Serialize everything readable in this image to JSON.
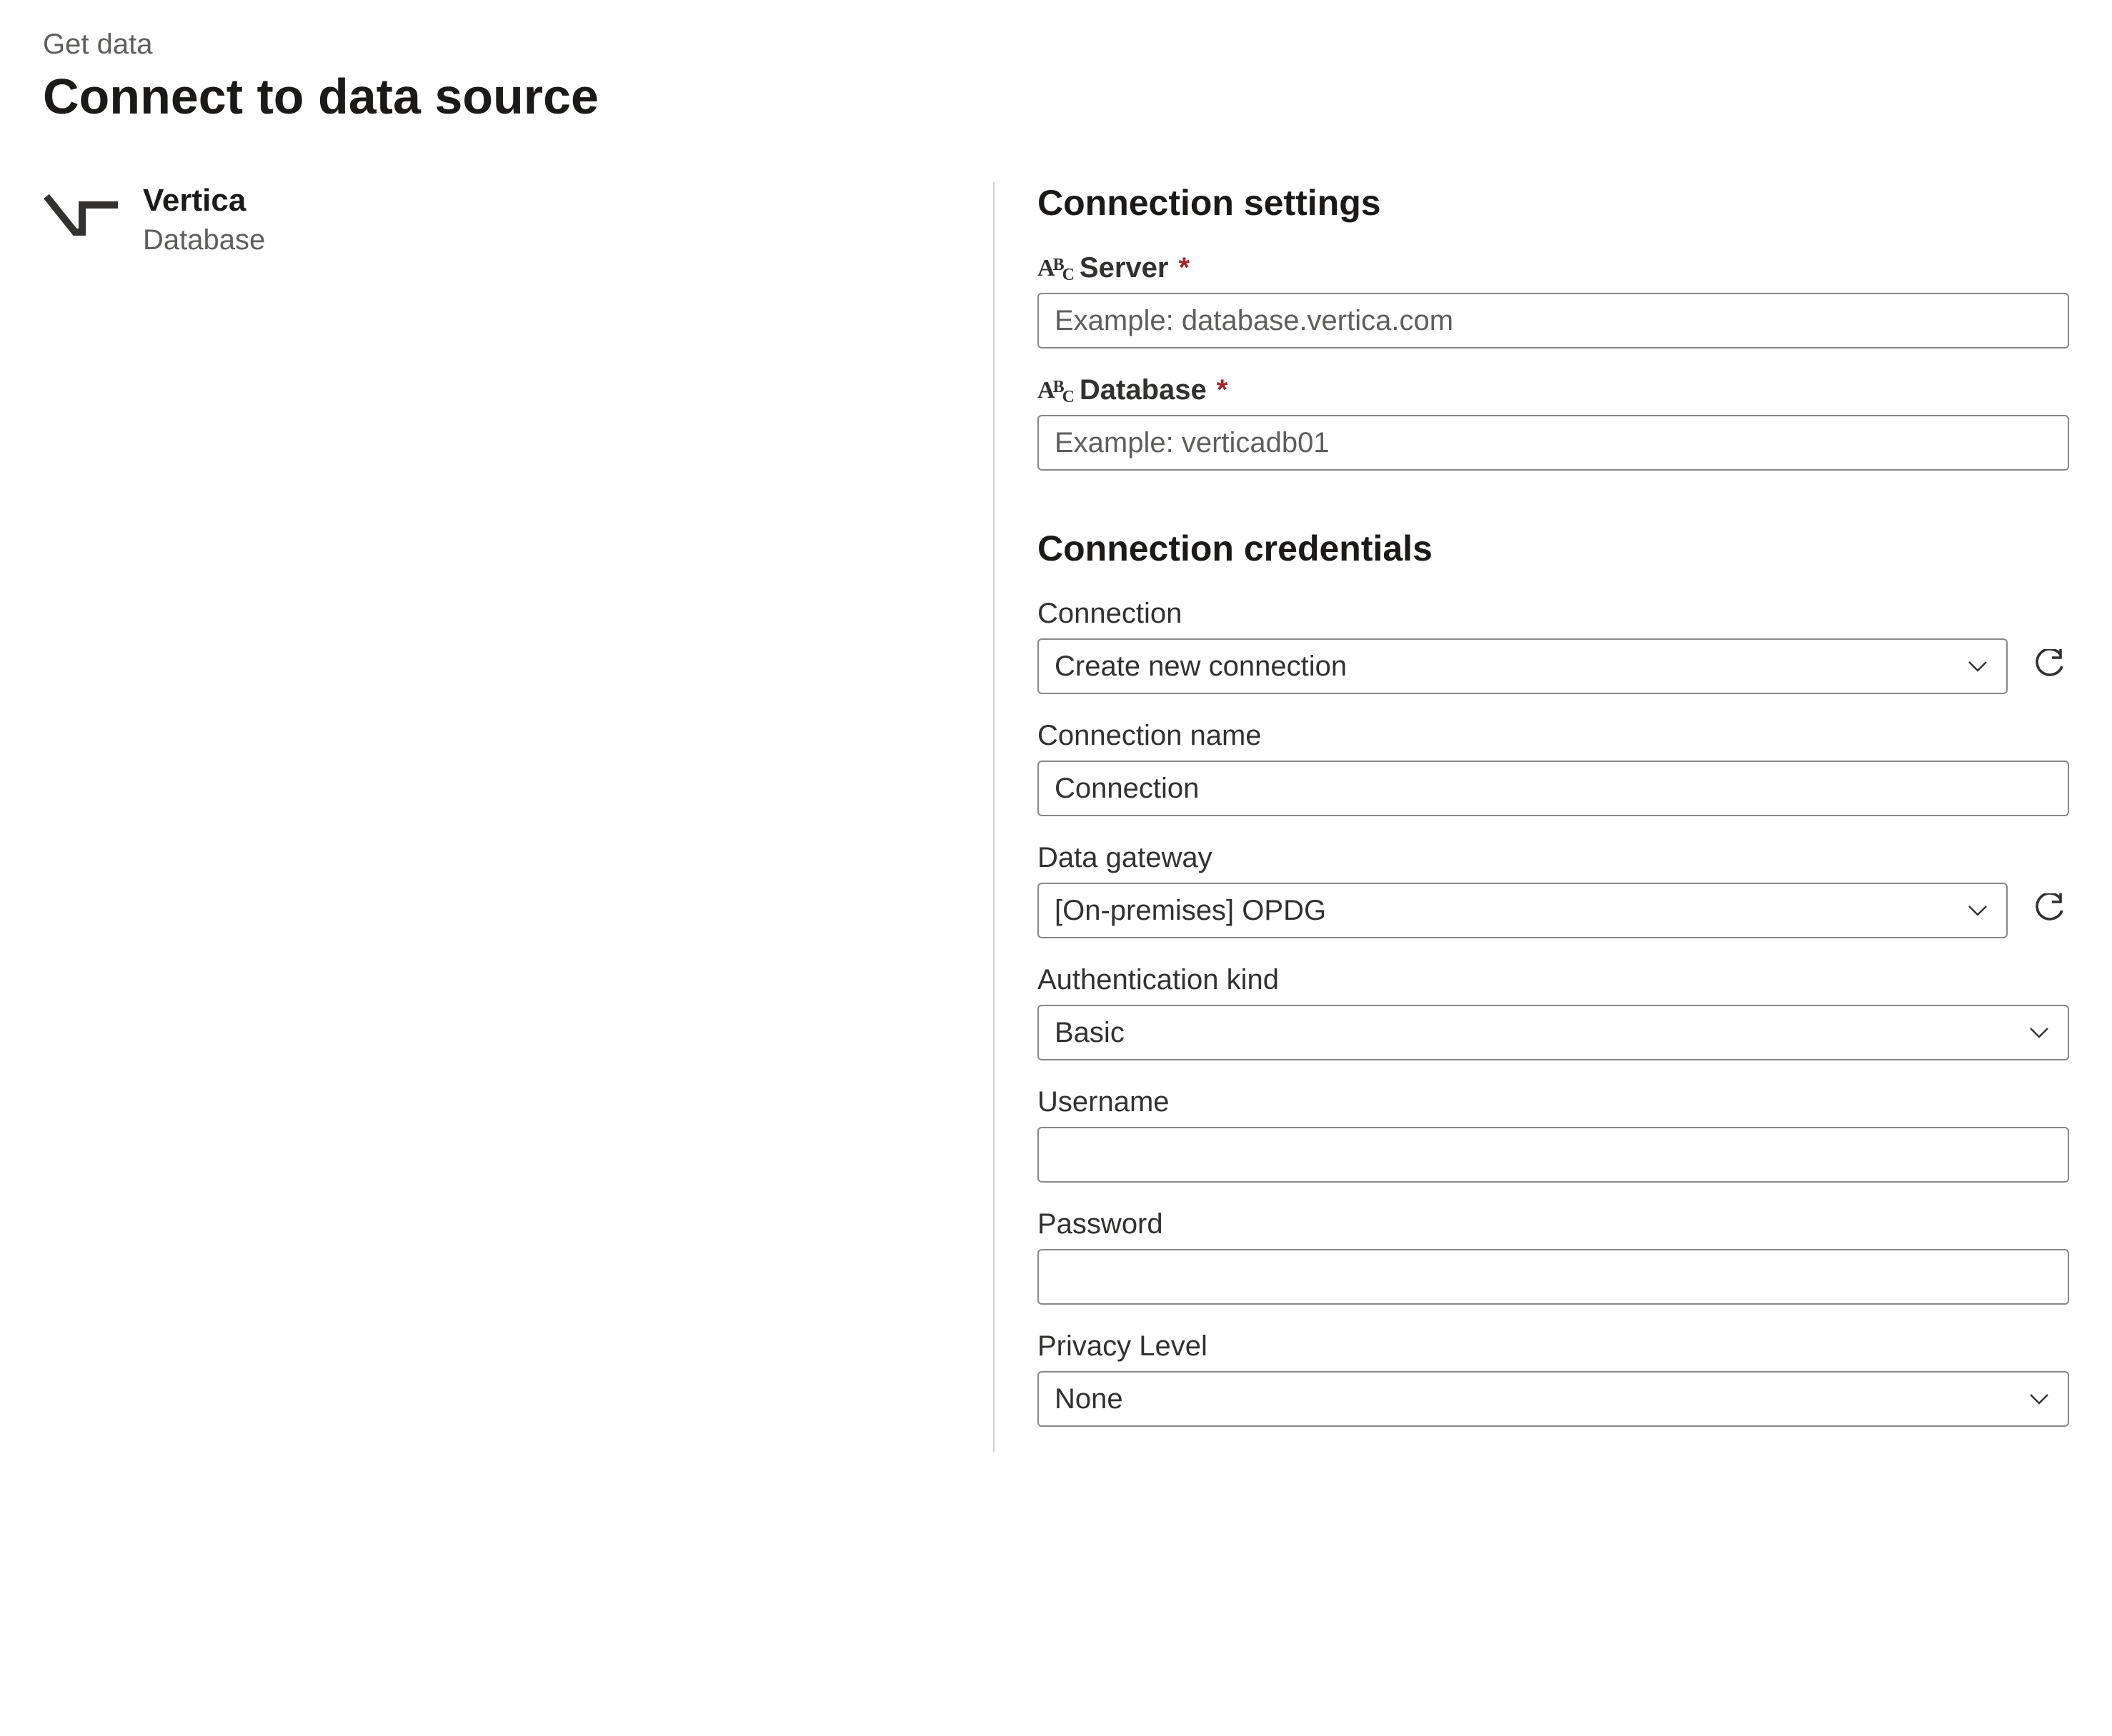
{
  "breadcrumb": "Get data",
  "page_title": "Connect to data source",
  "source": {
    "name": "Vertica",
    "kind": "Database"
  },
  "settings": {
    "heading": "Connection settings",
    "server": {
      "label": "Server",
      "required": true,
      "placeholder": "Example: database.vertica.com",
      "value": ""
    },
    "database": {
      "label": "Database",
      "required": true,
      "placeholder": "Example: verticadb01",
      "value": ""
    }
  },
  "credentials": {
    "heading": "Connection credentials",
    "connection": {
      "label": "Connection",
      "value": "Create new connection"
    },
    "connection_name": {
      "label": "Connection name",
      "value": "Connection"
    },
    "gateway": {
      "label": "Data gateway",
      "value": "[On-premises] OPDG"
    },
    "auth_kind": {
      "label": "Authentication kind",
      "value": "Basic"
    },
    "username": {
      "label": "Username",
      "value": ""
    },
    "password": {
      "label": "Password",
      "value": ""
    },
    "privacy": {
      "label": "Privacy Level",
      "value": "None"
    }
  }
}
